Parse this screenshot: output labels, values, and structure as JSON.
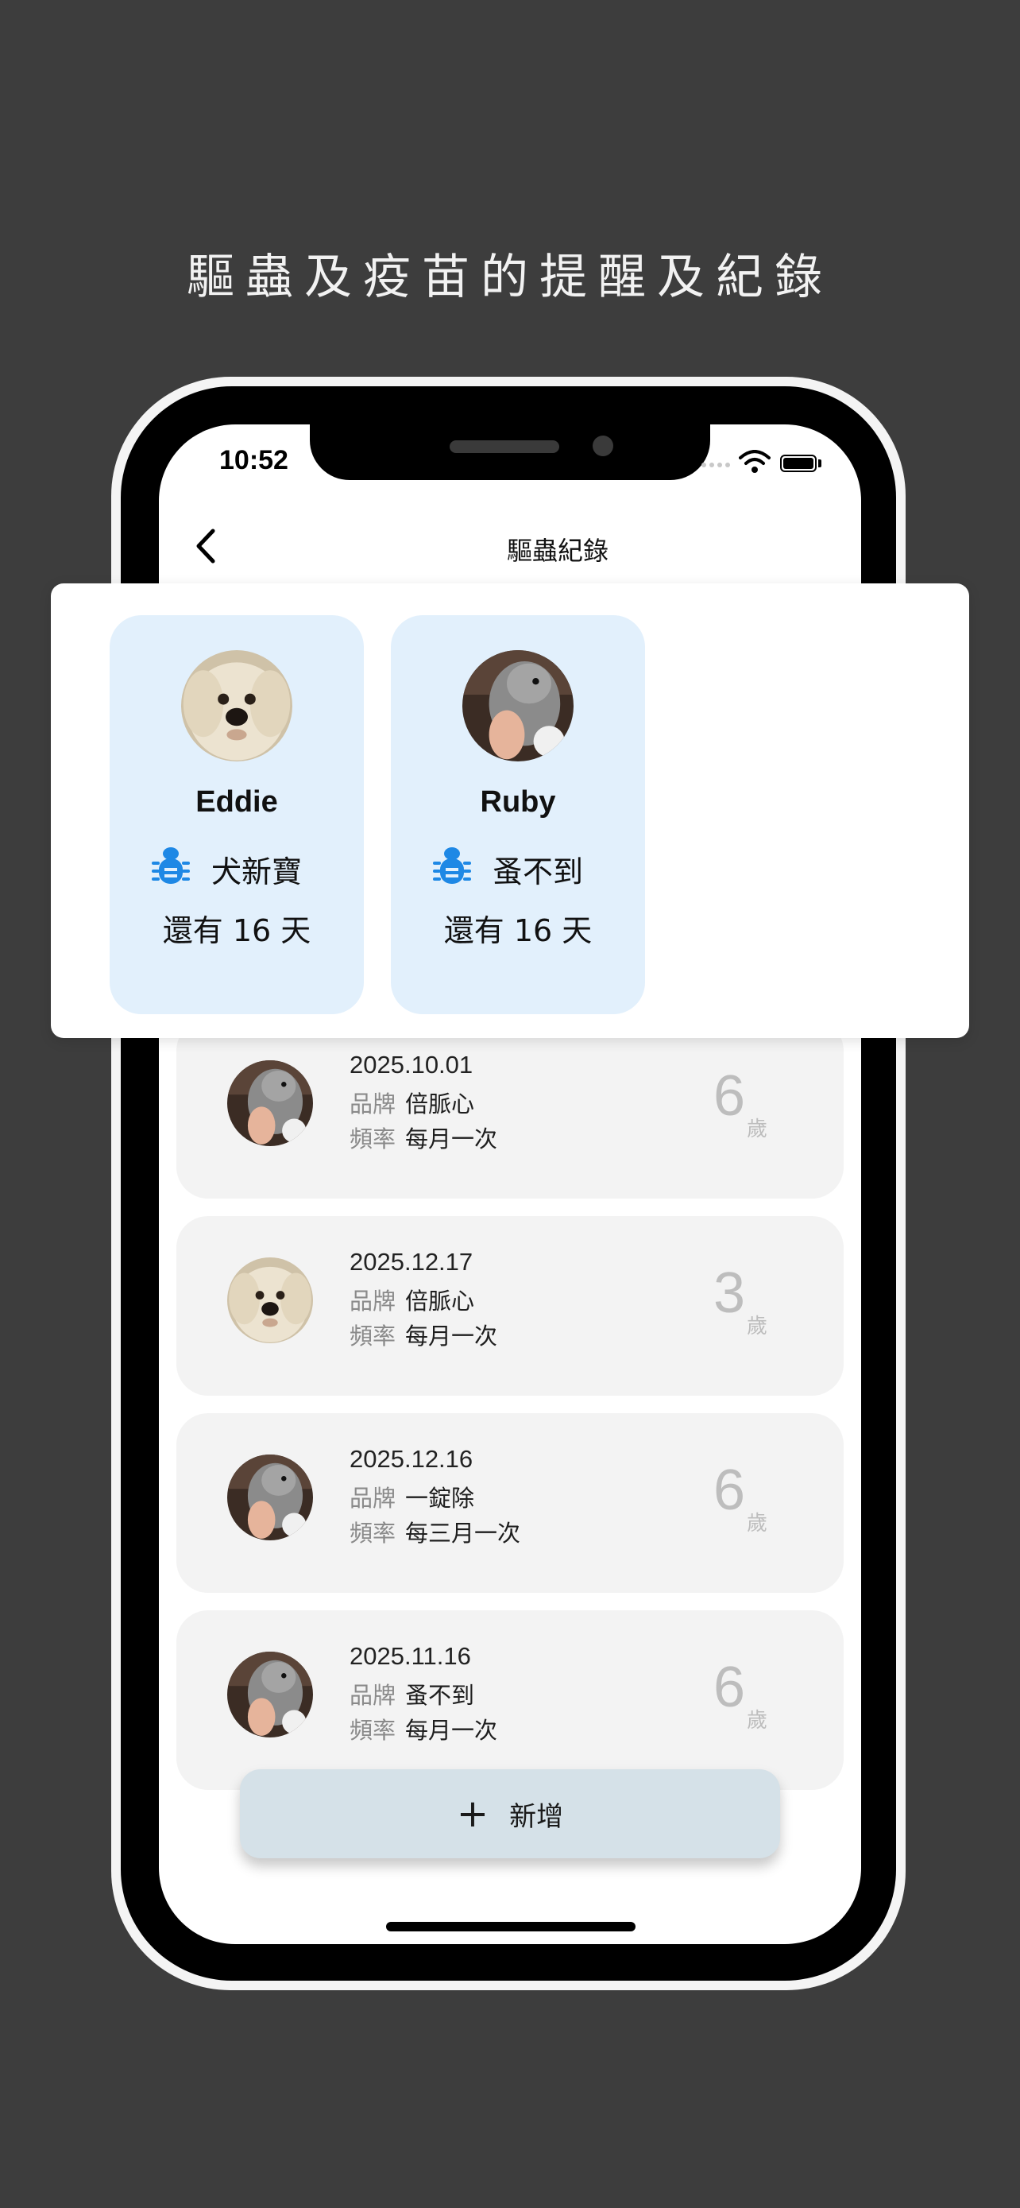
{
  "headline": "驅蟲及疫苗的提醒及紀錄",
  "status_bar": {
    "time": "10:52"
  },
  "nav": {
    "title": "驅蟲紀錄"
  },
  "pet_cards": [
    {
      "name": "Eddie",
      "product": "犬新寶",
      "remaining": "還有 16 天"
    },
    {
      "name": "Ruby",
      "product": "蚤不到",
      "remaining": "還有 16 天"
    }
  ],
  "records": [
    {
      "date": "2025.10.01",
      "brand_label": "品牌",
      "brand": "倍脈心",
      "freq_label": "頻率",
      "frequency": "每月一次",
      "age": "6",
      "age_unit": "歲",
      "pet": "Ruby"
    },
    {
      "date": "2025.12.17",
      "brand_label": "品牌",
      "brand": "倍脈心",
      "freq_label": "頻率",
      "frequency": "每月一次",
      "age": "3",
      "age_unit": "歲",
      "pet": "Eddie"
    },
    {
      "date": "2025.12.16",
      "brand_label": "品牌",
      "brand": "一錠除",
      "freq_label": "頻率",
      "frequency": "每三月一次",
      "age": "6",
      "age_unit": "歲",
      "pet": "Ruby"
    },
    {
      "date": "2025.11.16",
      "brand_label": "品牌",
      "brand": "蚤不到",
      "freq_label": "頻率",
      "frequency": "每月一次",
      "age": "6",
      "age_unit": "歲",
      "pet": "Ruby"
    }
  ],
  "add_button": {
    "icon": "plus-icon",
    "label": "新增"
  },
  "colors": {
    "background": "#3d3d3d",
    "card_blue": "#e2f0fc",
    "bug_icon": "#1e88e5",
    "add_button": "#d5e1e8"
  }
}
